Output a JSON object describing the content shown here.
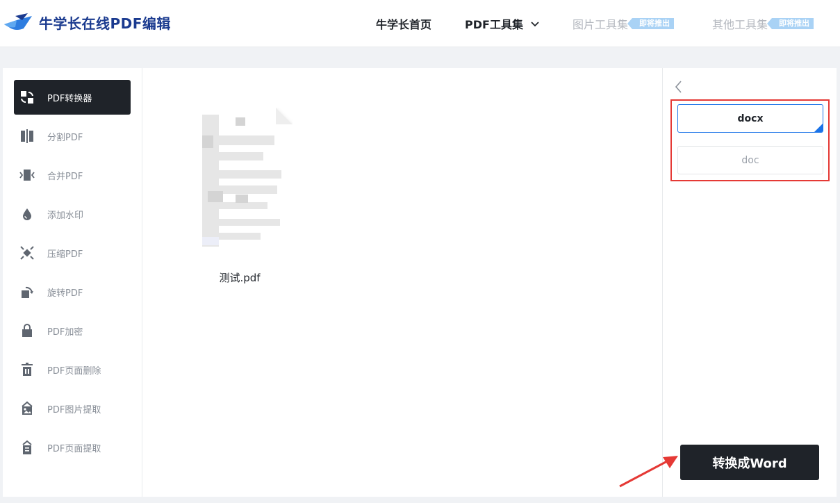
{
  "header": {
    "logo_text": "牛学长在线PDF编辑",
    "nav": {
      "home": "牛学长首页",
      "pdf_tools": "PDF工具集",
      "image_tools": "图片工具集",
      "image_tools_badge": "即将推出",
      "other_tools": "其他工具集",
      "other_tools_badge": "即将推出"
    }
  },
  "sidebar": {
    "items": [
      {
        "label": "PDF转换器",
        "icon": "convert-icon",
        "active": true
      },
      {
        "label": "分割PDF",
        "icon": "split-icon"
      },
      {
        "label": "合并PDF",
        "icon": "merge-icon"
      },
      {
        "label": "添加水印",
        "icon": "watermark-drop-icon"
      },
      {
        "label": "压缩PDF",
        "icon": "compress-icon"
      },
      {
        "label": "旋转PDF",
        "icon": "rotate-icon"
      },
      {
        "label": "PDF加密",
        "icon": "lock-icon"
      },
      {
        "label": "PDF页面删除",
        "icon": "trash-icon"
      },
      {
        "label": "PDF图片提取",
        "icon": "image-extract-icon"
      },
      {
        "label": "PDF页面提取",
        "icon": "page-extract-icon"
      }
    ]
  },
  "content": {
    "file": {
      "name": "测试.pdf"
    }
  },
  "right_panel": {
    "formats": [
      {
        "label": "docx",
        "selected": true
      },
      {
        "label": "doc",
        "selected": false
      }
    ],
    "convert_button": "转换成Word"
  },
  "colors": {
    "dark": "#1f2329",
    "accent": "#1a73e8",
    "highlight_red": "#e53935",
    "brand_blue": "#1a3a8f"
  }
}
